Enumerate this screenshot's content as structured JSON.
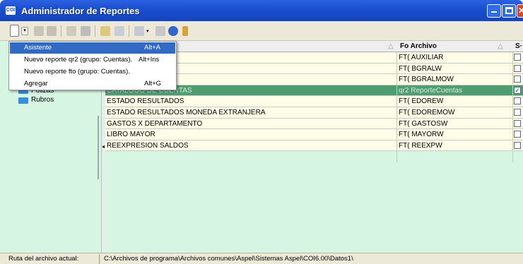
{
  "window": {
    "title": "Administrador de Reportes",
    "icon_text": "COI"
  },
  "menu": {
    "items": [
      {
        "label": "Asistente",
        "shortcut": "Alt+A"
      },
      {
        "label": "Nuevo reporte qr2 (grupo: Cuentas).",
        "shortcut": "Alt+Ins"
      },
      {
        "label": "Nuevo reporte fto (grupo: Cuentas).",
        "shortcut": ""
      },
      {
        "label": "Agregar",
        "shortcut": "Alt+G"
      }
    ]
  },
  "tree": {
    "partial_label": "Pólizas",
    "items": [
      "Rubros"
    ]
  },
  "grid": {
    "columns": [
      {
        "label": "",
        "sort": "△"
      },
      {
        "label": "Fo Archivo",
        "sort": "△"
      },
      {
        "label": "S·",
        "sort": "△"
      }
    ],
    "rows": [
      {
        "name": "TAS",
        "file": "FT( AUXILIAR",
        "checked": false
      },
      {
        "name": "",
        "file": "FT( BGRALW",
        "checked": false
      },
      {
        "name": "EDA EXTRANJERA",
        "file": "FT( BGRALMOW",
        "checked": false
      },
      {
        "name": "CATALOGO DE CUENTAS",
        "file": "qr2 ReporteCuentas",
        "checked": true
      },
      {
        "name": "ESTADO RESULTADOS",
        "file": "FT( EDOREW",
        "checked": false
      },
      {
        "name": "ESTADO RESULTADOS MONEDA EXTRANJERA",
        "file": "FT( EDOREMOW",
        "checked": false
      },
      {
        "name": "GASTOS X DEPARTAMENTO",
        "file": "FT( GASTOSW",
        "checked": false
      },
      {
        "name": "LIBRO MAYOR",
        "file": "FT( MAYORW",
        "checked": false
      },
      {
        "name": "REEXPRESION SALDOS",
        "file": "FT( REEXPW",
        "checked": false
      }
    ]
  },
  "status": {
    "label": "Ruta del archivo actual:",
    "path": "C:\\Archivos de programa\\Archivos comunes\\Aspel\\Sistemas Aspel\\COI6.00\\Datos1\\"
  }
}
